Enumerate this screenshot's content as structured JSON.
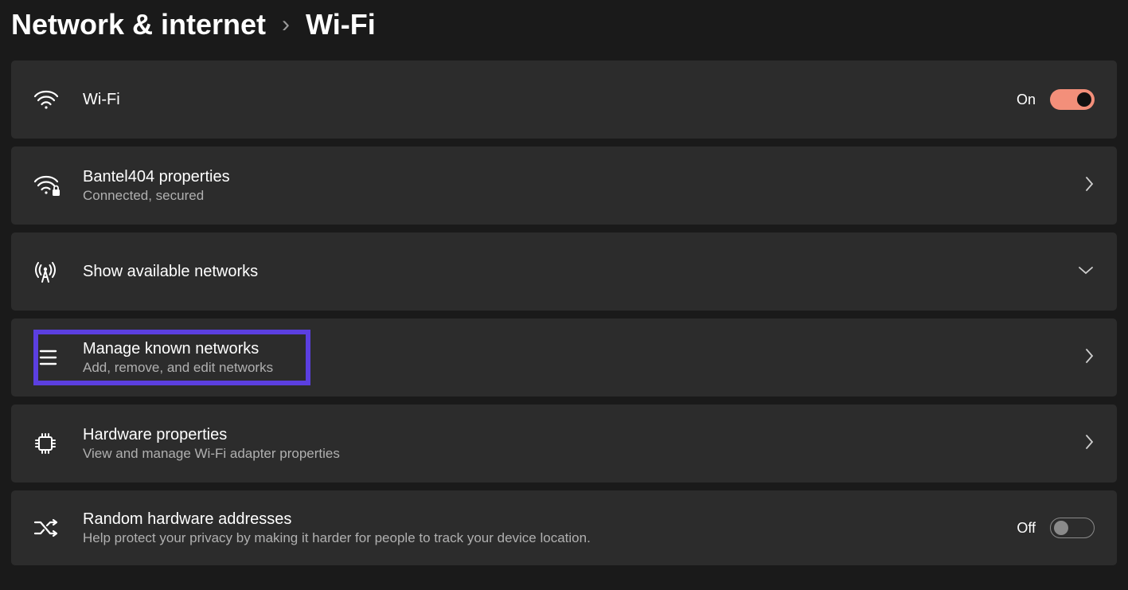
{
  "breadcrumb": {
    "parent": "Network & internet",
    "separator": "›",
    "current": "Wi-Fi"
  },
  "wifi_row": {
    "title": "Wi-Fi",
    "state_label": "On",
    "toggle_on": true
  },
  "properties_row": {
    "title": "Bantel404 properties",
    "subtitle": "Connected, secured"
  },
  "available_row": {
    "title": "Show available networks"
  },
  "manage_row": {
    "title": "Manage known networks",
    "subtitle": "Add, remove, and edit networks"
  },
  "hardware_row": {
    "title": "Hardware properties",
    "subtitle": "View and manage Wi-Fi adapter properties"
  },
  "random_row": {
    "title": "Random hardware addresses",
    "subtitle": "Help protect your privacy by making it harder for people to track your device location.",
    "state_label": "Off",
    "toggle_on": false
  },
  "colors": {
    "accent": "#f38f7a",
    "highlight": "#5b3fe0"
  }
}
